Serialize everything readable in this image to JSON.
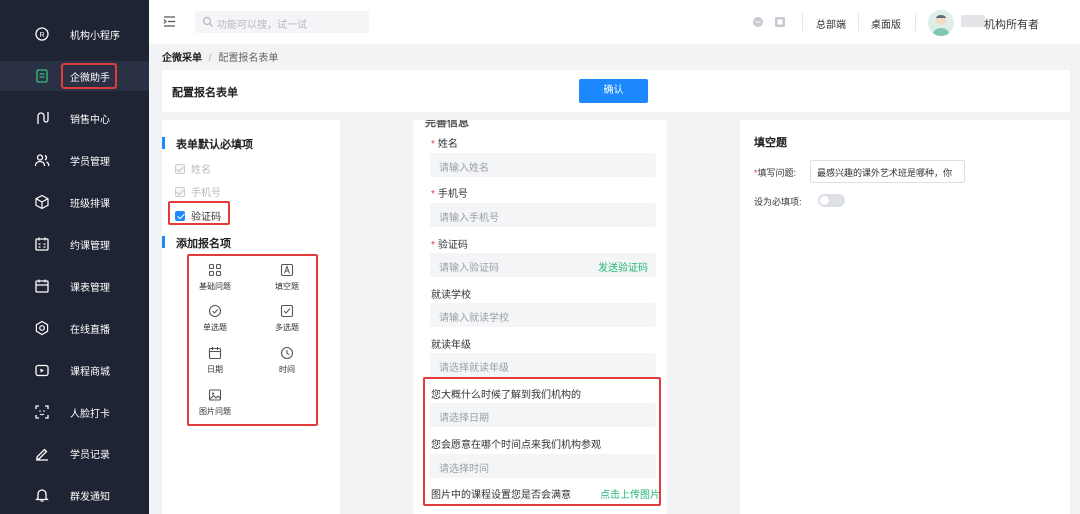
{
  "sidebar": {
    "items": [
      {
        "label": "机构小程序",
        "icon": "mini-program-icon"
      },
      {
        "label": "企微助手",
        "icon": "wecom-assistant-icon",
        "active": true
      },
      {
        "label": "销售中心",
        "icon": "sales-icon"
      },
      {
        "label": "学员管理",
        "icon": "students-icon"
      },
      {
        "label": "班级排课",
        "icon": "class-schedule-icon"
      },
      {
        "label": "约课管理",
        "icon": "booking-icon"
      },
      {
        "label": "课表管理",
        "icon": "timetable-icon"
      },
      {
        "label": "在线直播",
        "icon": "live-icon"
      },
      {
        "label": "课程商城",
        "icon": "course-mall-icon"
      },
      {
        "label": "人脸打卡",
        "icon": "face-checkin-icon"
      },
      {
        "label": "学员记录",
        "icon": "records-icon"
      },
      {
        "label": "群发通知",
        "icon": "bell-icon"
      }
    ]
  },
  "topbar": {
    "search_placeholder": "功能可以搜，试一试",
    "hq_label": "总部端",
    "desktop_label": "桌面版",
    "owner_label": "机构所有者"
  },
  "breadcrumb": {
    "root": "企微采单",
    "sep": "/",
    "current": "配置报名表单"
  },
  "header": {
    "title": "配置报名表单",
    "confirm_label": "确认"
  },
  "left": {
    "required_title": "表单默认必填项",
    "required_items": [
      {
        "label": "姓名",
        "state": "disabled"
      },
      {
        "label": "手机号",
        "state": "disabled"
      },
      {
        "label": "验证码",
        "state": "checked"
      }
    ],
    "add_title": "添加报名项",
    "tools": [
      {
        "label": "基础问题",
        "icon": "grid-icon"
      },
      {
        "label": "填空题",
        "icon": "text-a-icon"
      },
      {
        "label": "单选题",
        "icon": "check-circle-icon"
      },
      {
        "label": "多选题",
        "icon": "check-square-icon"
      },
      {
        "label": "日期",
        "icon": "calendar-icon"
      },
      {
        "label": "时间",
        "icon": "clock-icon"
      },
      {
        "label": "图片问题",
        "icon": "image-icon"
      }
    ]
  },
  "middle": {
    "cut_title": "完善信息",
    "fields": [
      {
        "label": "姓名",
        "required": "*",
        "placeholder": "请输入姓名"
      },
      {
        "label": "手机号",
        "required": "*",
        "placeholder": "请输入手机号"
      },
      {
        "label": "验证码",
        "required": "*",
        "placeholder": "请输入验证码",
        "action": "发送验证码"
      },
      {
        "label": "就读学校",
        "placeholder": "请输入就读学校"
      },
      {
        "label": "就读年级",
        "placeholder": "请选择就读年级"
      },
      {
        "label": "您大概什么时候了解到我们机构的",
        "placeholder": "请选择日期"
      },
      {
        "label": "您会愿意在哪个时间点来我们机构参观",
        "placeholder": "请选择时间"
      },
      {
        "label": "图片中的课程设置您是否会满意",
        "action": "点击上传图片"
      }
    ]
  },
  "right": {
    "title": "填空题",
    "question_label": "填写问题:",
    "question_required": "*",
    "question_value": "最感兴趣的课外艺术班是哪种，你",
    "required_label": "设为必填项:",
    "required_on": false
  }
}
